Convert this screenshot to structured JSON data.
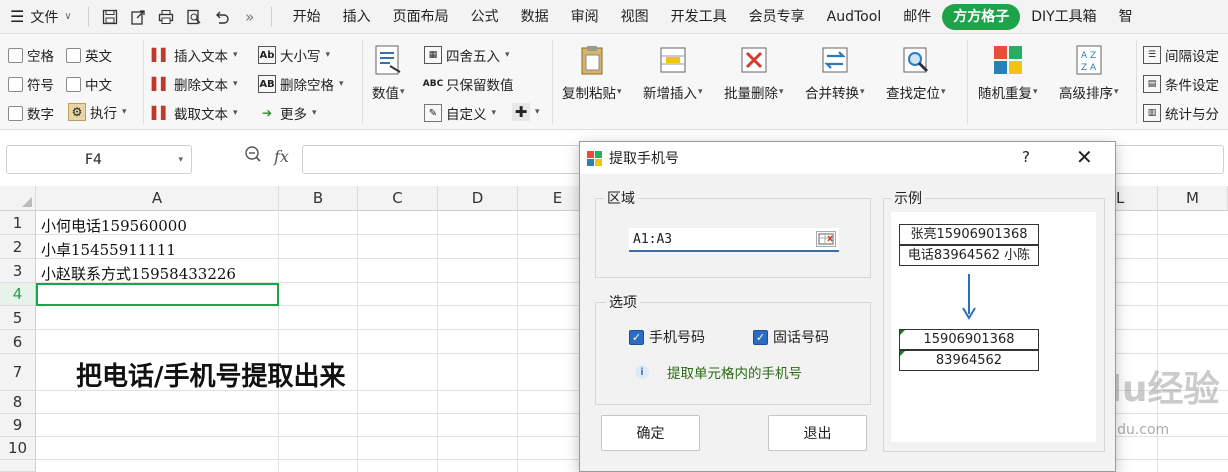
{
  "menubar": {
    "file_label": "文件",
    "tabs": [
      {
        "label": "开始"
      },
      {
        "label": "插入"
      },
      {
        "label": "页面布局"
      },
      {
        "label": "公式"
      },
      {
        "label": "数据"
      },
      {
        "label": "审阅"
      },
      {
        "label": "视图"
      },
      {
        "label": "开发工具"
      },
      {
        "label": "会员专享"
      },
      {
        "label": "AudTool"
      },
      {
        "label": "邮件"
      },
      {
        "label": "方方格子"
      },
      {
        "label": "DIY工具箱"
      },
      {
        "label": "智"
      }
    ],
    "active_tab": "方方格子",
    "accent_color": "#1fa34a"
  },
  "ribbon": {
    "checkboxes": [
      "空格",
      "英文",
      "符号",
      "中文",
      "数字"
    ],
    "exec_label": "执行",
    "text_tools": [
      "插入文本",
      "删除文本",
      "截取文本"
    ],
    "case_tools": [
      "大小写",
      "删除空格",
      "更多"
    ],
    "number_label": "数值",
    "round_tools": [
      "四舍五入",
      "只保留数值",
      "自定义"
    ],
    "big_buttons": [
      "复制粘贴",
      "新增插入",
      "批量删除",
      "合并转换",
      "查找定位",
      "随机重复",
      "高级排序"
    ],
    "right_tools": [
      "间隔设定",
      "条件设定",
      "统计与分"
    ]
  },
  "formula_bar": {
    "name_box": "F4",
    "fx_label": "fx",
    "content": ""
  },
  "sheet": {
    "columns": [
      "A",
      "B",
      "C",
      "D",
      "E",
      "L",
      "M"
    ],
    "rows": [
      "1",
      "2",
      "3",
      "4",
      "5",
      "6",
      "7",
      "8",
      "9",
      "10"
    ],
    "cells": {
      "A1": "小何电话159560000",
      "A2": "小卓15455911111",
      "A3": "小赵联系方式15958433226",
      "A7": "把电话/手机号提取出来"
    },
    "selected_row": "4"
  },
  "dialog": {
    "title": "提取手机号",
    "help": "?",
    "close": "✕",
    "region_label": "区域",
    "range_value": "A1:A3",
    "options_label": "选项",
    "option_mobile": "手机号码",
    "option_landline": "固话号码",
    "hint": "提取单元格内的手机号",
    "ok_label": "确定",
    "exit_label": "退出",
    "example_label": "示例",
    "example_inputs": [
      "张亮15906901368",
      "电话83964562 小陈"
    ],
    "example_outputs": [
      "15906901368",
      "83964562"
    ]
  },
  "watermark": {
    "logo": "Baidu经验",
    "url": "jingyan.baidu.com"
  }
}
